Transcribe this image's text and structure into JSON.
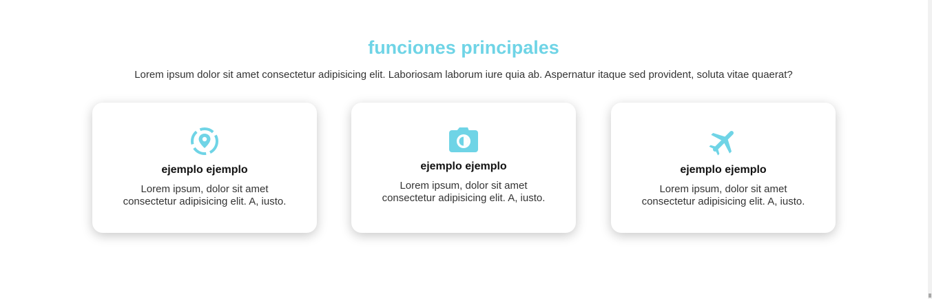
{
  "section": {
    "title": "funciones principales",
    "subtitle": "Lorem ipsum dolor sit amet consectetur adipisicing elit. Laboriosam laborum iure quia ab. Aspernatur itaque sed provident, soluta vitae quaerat?"
  },
  "colors": {
    "accent": "#6fd4e6",
    "text": "#333333",
    "heading": "#111111"
  },
  "cards": [
    {
      "icon": "map-marker-dashed-circle-icon",
      "title": "ejemplo ejemplo",
      "text": "Lorem ipsum, dolor sit amet consectetur adipisicing elit. A, iusto."
    },
    {
      "icon": "camera-icon",
      "title": "ejemplo ejemplo",
      "text": "Lorem ipsum, dolor sit amet consectetur adipisicing elit. A, iusto."
    },
    {
      "icon": "airplane-icon",
      "title": "ejemplo ejemplo",
      "text": "Lorem ipsum, dolor sit amet consectetur adipisicing elit. A, iusto."
    }
  ]
}
